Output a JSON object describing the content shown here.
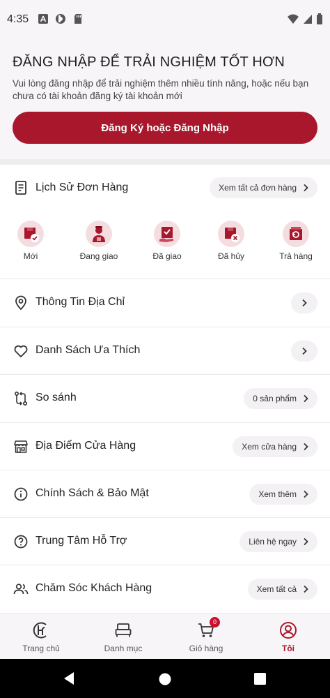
{
  "status_bar": {
    "time": "4:35"
  },
  "login": {
    "title": "ĐĂNG NHẬP ĐỂ TRẢI NGHIỆM TỐT HƠN",
    "description": "Vui lòng đăng nhập để trải nghiệm thêm nhiều tính năng, hoặc nếu bạn chưa có tài khoản đăng ký tài khoản mới",
    "button_label": "Đăng Ký hoặc Đăng Nhập"
  },
  "orders": {
    "label": "Lịch Sử Đơn Hàng",
    "view_all": "Xem tất cả đơn hàng",
    "statuses": [
      {
        "label": "Mới",
        "icon": "new-order-icon"
      },
      {
        "label": "Đang giao",
        "icon": "delivery-person-icon"
      },
      {
        "label": "Đã giao",
        "icon": "delivered-icon"
      },
      {
        "label": "Đã hủy",
        "icon": "cancelled-icon"
      },
      {
        "label": "Trả hàng",
        "icon": "return-icon"
      }
    ]
  },
  "menu": {
    "address": {
      "label": "Thông Tin Địa Chỉ",
      "icon": "location-pin-icon"
    },
    "wishlist": {
      "label": "Danh Sách Ưa Thích",
      "icon": "heart-icon"
    },
    "compare": {
      "label": "So sánh",
      "action": "0 sản phẩm",
      "icon": "compare-icon"
    },
    "stores": {
      "label": "Địa Điểm Cửa Hàng",
      "action": "Xem cửa hàng",
      "icon": "store-icon"
    },
    "policy": {
      "label": "Chính Sách & Bảo Mật",
      "action": "Xem thêm",
      "icon": "info-icon"
    },
    "support": {
      "label": "Trung Tâm Hỗ Trợ",
      "action": "Liên hệ ngay",
      "icon": "help-icon"
    },
    "customer_care": {
      "label": "Chăm Sóc Khách Hàng",
      "action": "Xem tất cả",
      "icon": "users-icon"
    }
  },
  "bottom_nav": {
    "items": [
      {
        "label": "Trang chủ",
        "icon": "home-logo-icon"
      },
      {
        "label": "Danh mục",
        "icon": "bed-icon"
      },
      {
        "label": "Giỏ hàng",
        "icon": "cart-icon",
        "badge": "0"
      },
      {
        "label": "Tôi",
        "icon": "user-circle-icon",
        "active": true
      }
    ]
  },
  "colors": {
    "accent": "#a8172b",
    "soft_accent": "#f4dde1",
    "pill_bg": "#f3f1f4"
  }
}
